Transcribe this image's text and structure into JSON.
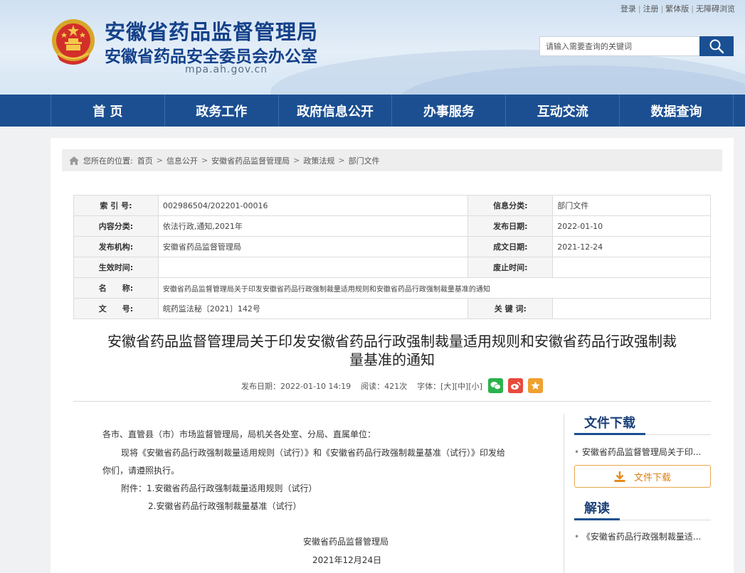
{
  "header": {
    "title": "安徽省药品监督管理局",
    "subtitle": "安徽省药品安全委员会办公室",
    "domain": "mpa.ah.gov.cn",
    "top_links": [
      "登录",
      "注册",
      "繁体版",
      "无障碍浏览"
    ],
    "search_placeholder": "请输入需要查询的关键词"
  },
  "nav": [
    "首 页",
    "政务工作",
    "政府信息公开",
    "办事服务",
    "互动交流",
    "数据查询"
  ],
  "breadcrumb": {
    "prefix": "您所在的位置:",
    "items": [
      "首页",
      "信息公开",
      "安徽省药品监督管理局",
      "政策法规",
      "部门文件"
    ]
  },
  "meta": {
    "index_label": "索 引 号:",
    "index_value": "002986504/202201-00016",
    "category_label": "信息分类:",
    "category_value": "部门文件",
    "topic_label": "内容分类:",
    "topic_value": "依法行政,通知,2021年",
    "pubdate_label": "发布日期:",
    "pubdate_value": "2022-01-10",
    "org_label": "发布机构:",
    "org_value": "安徽省药品监督管理局",
    "made_label": "成文日期:",
    "made_value": "2021-12-24",
    "effective_label": "生效时间:",
    "effective_value": "",
    "abolish_label": "废止时间:",
    "abolish_value": "",
    "name_label": "名　　称:",
    "name_value": "安徽省药品监督管理局关于印发安徽省药品行政强制裁量适用规则和安徽省药品行政强制裁量基准的通知",
    "docno_label": "文　　号:",
    "docno_value": "皖药监法秘〔2021〕142号",
    "keywords_label": "关 键 词:",
    "keywords_value": ""
  },
  "article": {
    "title_line1": "安徽省药品监督管理局关于印发安徽省药品行政强制裁量适用规则和安徽省药品行政强制裁",
    "title_line2": "量基准的通知",
    "pub_label": "发布日期：2022-01-10 14:19",
    "views_label": "阅读：421次",
    "fontsize_label": "字体：",
    "font_large": "[大]",
    "font_medium": "[中]",
    "font_small": "[小]",
    "body": {
      "salutation": "各市、直管县（市）市场监督管理局，局机关各处室、分局、直属单位：",
      "para1_line1": "现将《安徽省药品行政强制裁量适用规则（试行）》和《安徽省药品行政强制裁量基准（试行）》印发给",
      "para1_line2": "你们，请遵照执行。",
      "attach1": "附件：1.安徽省药品行政强制裁量适用规则（试行）",
      "attach2": "2.安徽省药品行政强制裁量基准（试行）",
      "signature": "安徽省药品监督管理局",
      "date": "2021年12月24日"
    }
  },
  "sidebar": {
    "download_title": "文件下载",
    "download_item": "安徽省药品监督管理局关于印...",
    "download_button": "文件下载",
    "interpret_title": "解读",
    "interpret_item": "《安徽省药品行政强制裁量适..."
  },
  "colors": {
    "nav_bg": "#1b4f91",
    "title_blue": "#14418a",
    "download_orange": "#d98118",
    "wechat_green": "#2bb24c",
    "weibo_red": "#e84a3c",
    "favorite_orange": "#f0a030"
  },
  "icons": [
    "national-emblem-icon",
    "search-icon",
    "home-icon",
    "wechat-icon",
    "weibo-icon",
    "favorite-icon",
    "download-icon"
  ]
}
